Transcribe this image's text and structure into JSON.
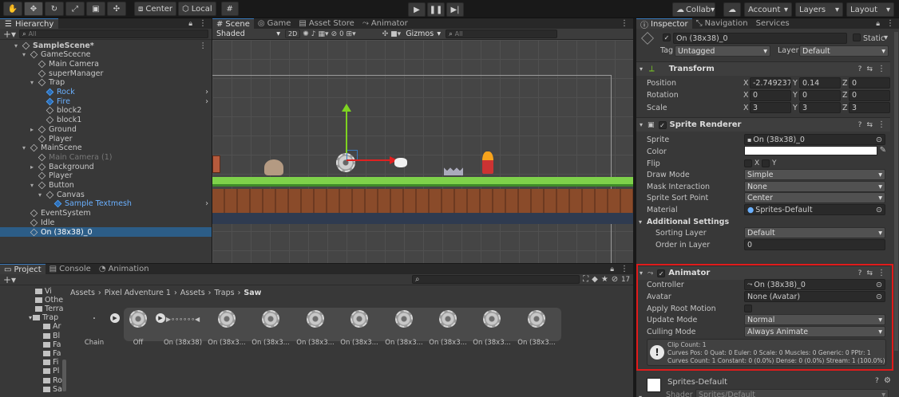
{
  "toolbar": {
    "pivot": "Center",
    "space": "Local",
    "collab": "Collab",
    "account": "Account",
    "layers": "Layers",
    "layout": "Layout"
  },
  "hierarchy": {
    "tab": "Hierarchy",
    "search_placeholder": "All",
    "items": [
      {
        "label": "SampleScene*",
        "depth": 0,
        "type": "scene",
        "expanded": true
      },
      {
        "label": "GameScecne",
        "depth": 1,
        "type": "object",
        "expanded": true
      },
      {
        "label": "Main Camera",
        "depth": 2,
        "type": "object"
      },
      {
        "label": "superManager",
        "depth": 2,
        "type": "object"
      },
      {
        "label": "Trap",
        "depth": 2,
        "type": "object",
        "expanded": true
      },
      {
        "label": "Rock",
        "depth": 3,
        "type": "prefab"
      },
      {
        "label": "Fire",
        "depth": 3,
        "type": "prefab"
      },
      {
        "label": "block2",
        "depth": 3,
        "type": "object"
      },
      {
        "label": "block1",
        "depth": 3,
        "type": "object"
      },
      {
        "label": "Ground",
        "depth": 2,
        "type": "object",
        "collapsed": true
      },
      {
        "label": "Player",
        "depth": 2,
        "type": "object"
      },
      {
        "label": "MainScene",
        "depth": 1,
        "type": "object",
        "expanded": true
      },
      {
        "label": "Main Camera (1)",
        "depth": 2,
        "type": "object",
        "disabled": true
      },
      {
        "label": "Background",
        "depth": 2,
        "type": "object",
        "collapsed": true
      },
      {
        "label": "Player",
        "depth": 2,
        "type": "object"
      },
      {
        "label": "Button",
        "depth": 2,
        "type": "object",
        "expanded": true
      },
      {
        "label": "Canvas",
        "depth": 3,
        "type": "object",
        "expanded": true
      },
      {
        "label": "Sample Textmesh",
        "depth": 4,
        "type": "prefab"
      },
      {
        "label": "EventSystem",
        "depth": 1,
        "type": "object"
      },
      {
        "label": "Idle",
        "depth": 1,
        "type": "object"
      },
      {
        "label": "On (38x38)_0",
        "depth": 1,
        "type": "object",
        "selected": true
      }
    ]
  },
  "scene": {
    "tabs": [
      "Scene",
      "Game",
      "Asset Store",
      "Animator"
    ],
    "shading": "Shaded",
    "mode2d": "2D",
    "hidden_count": "0",
    "gizmos": "Gizmos",
    "search_placeholder": "All"
  },
  "project": {
    "tabs": [
      "Project",
      "Console",
      "Animation"
    ],
    "breadcrumb": [
      "Assets",
      "Pixel Adventure 1",
      "Assets",
      "Traps",
      "Saw"
    ],
    "hidden_count": "17",
    "folders": [
      "Vi",
      "Othe",
      "Terra",
      "Trap",
      "Ar",
      "Bl",
      "Fa",
      "Fa",
      "Fi",
      "Pl",
      "Ro",
      "Sa"
    ],
    "assets": [
      "Chain",
      "Off",
      "On (38x38)",
      "On (38x3...",
      "On (38x3...",
      "On (38x3...",
      "On (38x3...",
      "On (38x3...",
      "On (38x3...",
      "On (38x3...",
      "On (38x3..."
    ]
  },
  "inspector": {
    "tabs": [
      "Inspector",
      "Navigation",
      "Services"
    ],
    "object_name": "On (38x38)_0",
    "static_label": "Static",
    "tag_label": "Tag",
    "tag_value": "Untagged",
    "layer_label": "Layer",
    "layer_value": "Default",
    "transform": {
      "title": "Transform",
      "rows": [
        {
          "label": "Position",
          "x": "-2.749237",
          "y": "0.14",
          "z": "0"
        },
        {
          "label": "Rotation",
          "x": "0",
          "y": "0",
          "z": "0"
        },
        {
          "label": "Scale",
          "x": "3",
          "y": "3",
          "z": "3"
        }
      ]
    },
    "sprite_renderer": {
      "title": "Sprite Renderer",
      "sprite_label": "Sprite",
      "sprite_value": "On (38x38)_0",
      "color_label": "Color",
      "flip_label": "Flip",
      "flip_x": "X",
      "flip_y": "Y",
      "draw_mode_label": "Draw Mode",
      "draw_mode_value": "Simple",
      "mask_label": "Mask Interaction",
      "mask_value": "None",
      "sort_point_label": "Sprite Sort Point",
      "sort_point_value": "Center",
      "material_label": "Material",
      "material_value": "Sprites-Default",
      "additional_label": "Additional Settings",
      "sorting_layer_label": "Sorting Layer",
      "sorting_layer_value": "Default",
      "order_label": "Order in Layer",
      "order_value": "0"
    },
    "animator": {
      "title": "Animator",
      "controller_label": "Controller",
      "controller_value": "On (38x38)_0",
      "avatar_label": "Avatar",
      "avatar_value": "None (Avatar)",
      "root_motion_label": "Apply Root Motion",
      "update_label": "Update Mode",
      "update_value": "Normal",
      "culling_label": "Culling Mode",
      "culling_value": "Always Animate",
      "info_lines": [
        "Clip Count: 1",
        "Curves Pos: 0 Quat: 0 Euler: 0 Scale: 0 Muscles: 0 Generic: 0 PPtr: 1",
        "Curves Count: 1 Constant: 0 (0.0%) Dense: 0 (0.0%) Stream: 1 (100.0%)"
      ]
    },
    "material": {
      "name": "Sprites-Default",
      "shader_label": "Shader",
      "shader_value": "Sprites/Default"
    }
  },
  "colors": {
    "accent": "#3a79bb",
    "highlight": "#e01b1b",
    "selection": "#2c5d87"
  }
}
